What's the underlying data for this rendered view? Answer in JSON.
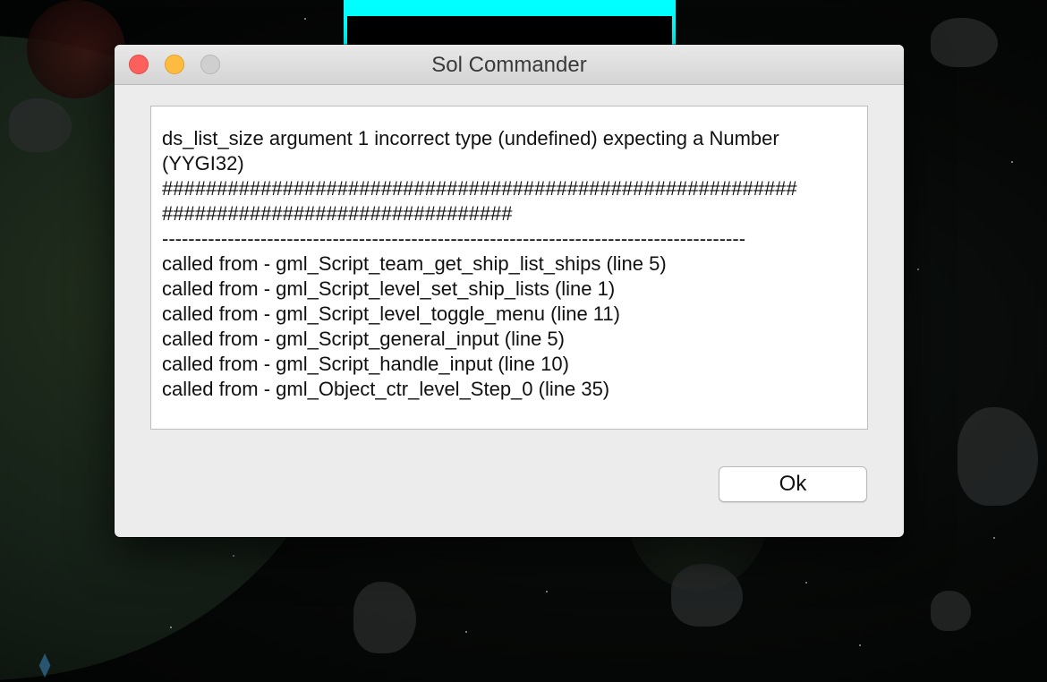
{
  "window": {
    "title": "Sol Commander"
  },
  "message": {
    "lines": [
      "ds_list_size argument 1 incorrect type (undefined) expecting a Number",
      "(YYGI32)",
      "##########################################################",
      "################################",
      "-----------------------------------------------------------------------------------------",
      "called from - gml_Script_team_get_ship_list_ships (line 5)",
      "called from - gml_Script_level_set_ship_lists (line 1)",
      "called from - gml_Script_level_toggle_menu (line 11)",
      "called from - gml_Script_general_input (line 5)",
      "called from - gml_Script_handle_input (line 10)",
      "called from - gml_Object_ctr_level_Step_0 (line 35)"
    ]
  },
  "buttons": {
    "ok_label": "Ok"
  },
  "colors": {
    "close": "#fc605c",
    "minimize": "#fdbc40",
    "zoom_disabled": "#cfcfcf",
    "hud_frame": "#00ffff"
  }
}
